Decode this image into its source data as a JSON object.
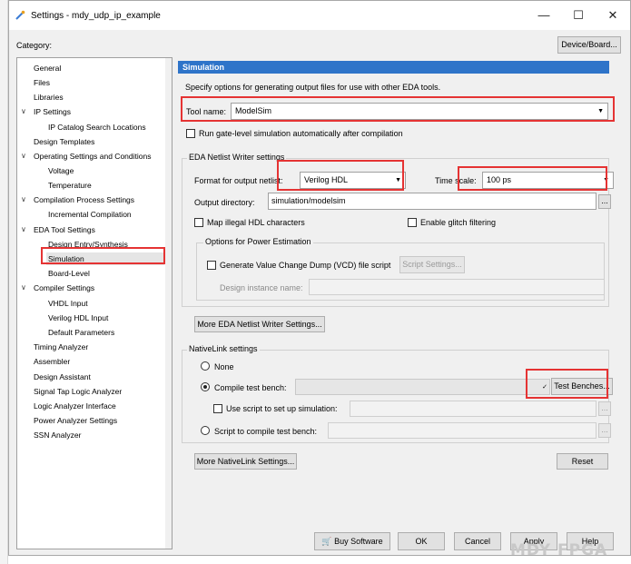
{
  "window": {
    "title": "Settings - mdy_udp_ip_example",
    "minimize": "—",
    "maximize": "☐",
    "close": "✕"
  },
  "category_label": "Category:",
  "device_board_button": "Device/Board...",
  "tree": {
    "items": [
      {
        "label": "General"
      },
      {
        "label": "Files"
      },
      {
        "label": "Libraries"
      },
      {
        "label": "IP Settings"
      },
      {
        "label": "IP Catalog Search Locations"
      },
      {
        "label": "Design Templates"
      },
      {
        "label": "Operating Settings and Conditions"
      },
      {
        "label": "Voltage"
      },
      {
        "label": "Temperature"
      },
      {
        "label": "Compilation Process Settings"
      },
      {
        "label": "Incremental Compilation"
      },
      {
        "label": "EDA Tool Settings"
      },
      {
        "label": "Design Entry/Synthesis"
      },
      {
        "label": "Simulation"
      },
      {
        "label": "Board-Level"
      },
      {
        "label": "Compiler Settings"
      },
      {
        "label": "VHDL Input"
      },
      {
        "label": "Verilog HDL Input"
      },
      {
        "label": "Default Parameters"
      },
      {
        "label": "Timing Analyzer"
      },
      {
        "label": "Assembler"
      },
      {
        "label": "Design Assistant"
      },
      {
        "label": "Signal Tap Logic Analyzer"
      },
      {
        "label": "Logic Analyzer Interface"
      },
      {
        "label": "Power Analyzer Settings"
      },
      {
        "label": "SSN Analyzer"
      }
    ],
    "selected": "Simulation"
  },
  "pane": {
    "header": "Simulation",
    "description": "Specify options for generating output files for use with other EDA tools.",
    "tool_name_label": "Tool name:",
    "tool_name_value": "ModelSim",
    "run_gate_level": "Run gate-level simulation automatically after compilation",
    "eda_netlist_group": "EDA Netlist Writer settings",
    "format_label": "Format for output netlist:",
    "format_value": "Verilog HDL",
    "time_scale_label": "Time scale:",
    "time_scale_value": "100 ps",
    "output_dir_label": "Output directory:",
    "output_dir_value": "simulation/modelsim",
    "browse": "...",
    "map_illegal": "Map illegal HDL characters",
    "enable_glitch": "Enable glitch filtering",
    "power_group": "Options for Power Estimation",
    "generate_vcd": "Generate Value Change Dump (VCD) file script",
    "script_settings": "Script Settings...",
    "design_instance_label": "Design instance name:",
    "more_eda_button": "More EDA Netlist Writer Settings...",
    "nativelink_group": "NativeLink settings",
    "none_label": "None",
    "compile_tb_label": "Compile test bench:",
    "test_benches_button": "Test Benches...",
    "use_script_label": "Use script to set up simulation:",
    "script_compile_label": "Script to compile test bench:",
    "more_nativelink_button": "More NativeLink Settings...",
    "reset_button": "Reset"
  },
  "footer": {
    "buy_software": "Buy Software",
    "ok": "OK",
    "cancel": "Cancel",
    "apply": "Apply",
    "help": "Help"
  },
  "watermark": "MDY FPGA"
}
